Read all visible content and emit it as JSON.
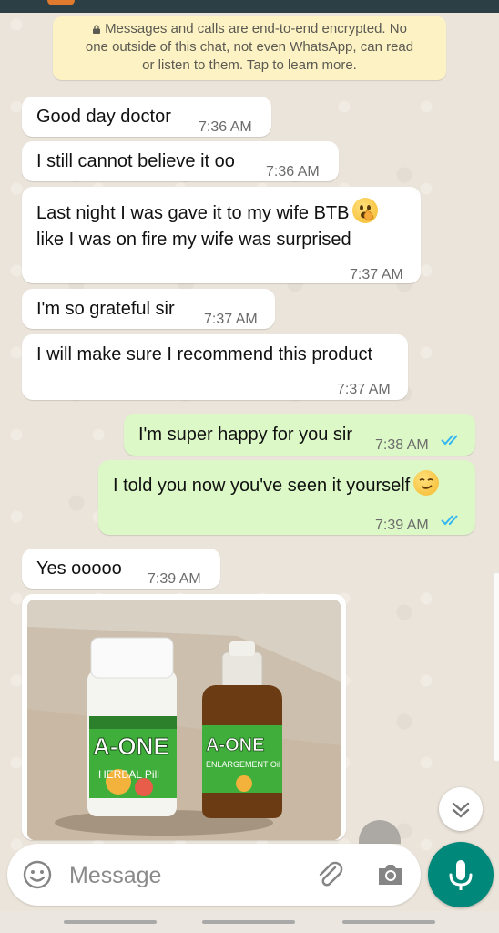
{
  "encryption_notice": {
    "line1": "Messages and calls are end-to-end encrypted. No",
    "line2": "one outside of this chat, not even WhatsApp, can read",
    "line3": "or listen to them. Tap to learn more."
  },
  "messages": [
    {
      "dir": "in",
      "text": "Good day doctor",
      "time": "7:36 AM"
    },
    {
      "dir": "in",
      "text": "I still cannot believe it oo",
      "time": "7:36 AM"
    },
    {
      "dir": "in",
      "line1": "Last night I was gave it to my wife BTB",
      "line2": "like I was on fire my wife was surprised",
      "time": "7:37 AM",
      "emoji": "face-with-hand-over-mouth"
    },
    {
      "dir": "in",
      "text": "I'm so grateful sir",
      "time": "7:37 AM"
    },
    {
      "dir": "in",
      "text": "I will make sure I recommend this product",
      "time": "7:37 AM"
    },
    {
      "dir": "out",
      "text": "I'm super happy for you sir",
      "time": "7:38 AM",
      "status": "read"
    },
    {
      "dir": "out",
      "text": "I told you now you've seen it yourself",
      "time": "7:39 AM",
      "status": "read",
      "emoji": "smirking-face"
    },
    {
      "dir": "in",
      "text": "Yes ooooo",
      "time": "7:39 AM"
    }
  ],
  "photo": {
    "bottle1_label": "A-ONE",
    "bottle1_sub": "HERBAL Pill",
    "bottle2_label": "A-ONE",
    "bottle2_sub": "ENLARGEMENT Oil"
  },
  "composer": {
    "placeholder": "Message"
  },
  "colors": {
    "incoming_bubble": "#ffffff",
    "outgoing_bubble": "#dcf8c6",
    "read_ticks": "#34b7f1",
    "mic_button": "#00897b",
    "encryption_bg": "#fdf2c4"
  }
}
